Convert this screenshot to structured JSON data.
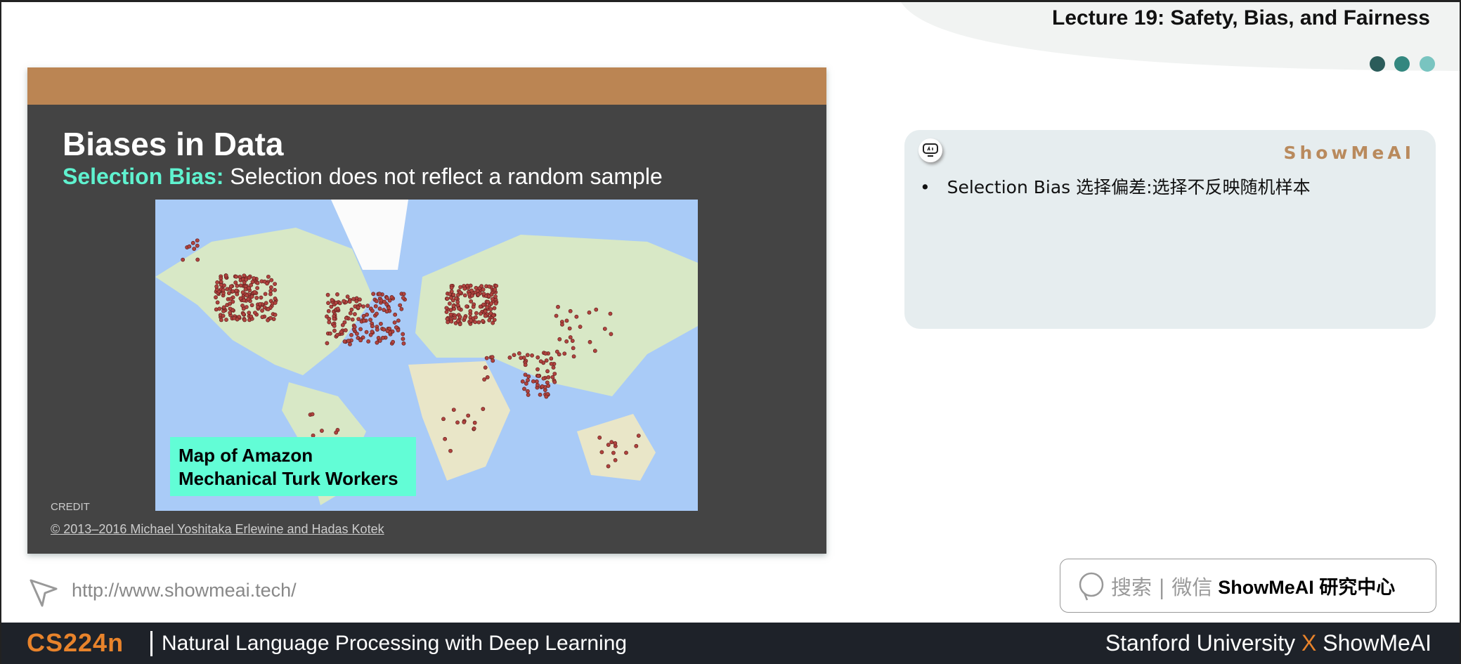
{
  "header": {
    "lecture_title": "Lecture 19: Safety, Bias, and Fairness",
    "dot_colors": [
      "#2b5c5a",
      "#33877f",
      "#79c4c0"
    ]
  },
  "slide": {
    "title": "Biases in Data",
    "subtitle_highlight": "Selection Bias:",
    "subtitle_rest": " Selection does not reflect a random sample",
    "map_label_line1": "Map of Amazon",
    "map_label_line2": "Mechanical Turk Workers",
    "credit_label": "CREDIT",
    "copyright": "© 2013–2016 Michael Yoshitaka Erlewine and Hadas Kotek",
    "colors": {
      "header_bar": "#bb8553",
      "highlight": "#5ff2cf",
      "label_bg": "#62fdd6"
    }
  },
  "note": {
    "brand": "ShowMeAI",
    "bullet": "Selection Bias 选择偏差:选择不反映随机样本",
    "icon": "robot-icon"
  },
  "bottom": {
    "url": "http://www.showmeai.tech/",
    "search_gray": "搜索 | 微信",
    "search_bold": "ShowMeAI 研究中心"
  },
  "footer": {
    "course_code": "CS224n",
    "course_name": "Natural Language Processing with Deep Learning",
    "uni": "Stanford University ",
    "x": "X",
    "brand": " ShowMeAI"
  }
}
